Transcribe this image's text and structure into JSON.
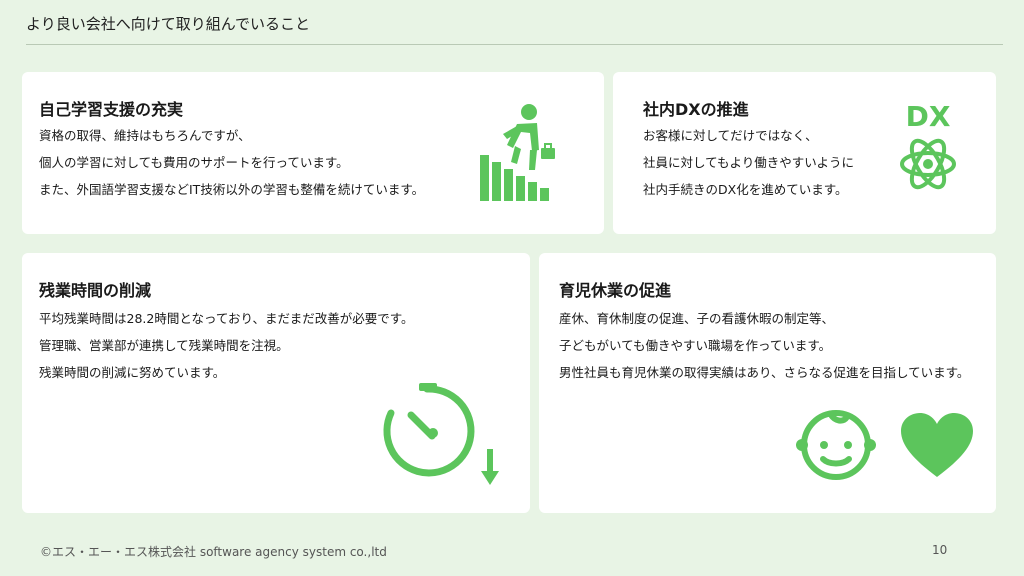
{
  "slide": {
    "title": "より良い会社へ向けて取り組んでいること"
  },
  "cards": [
    {
      "title": "自己学習支援の充実",
      "lines": [
        "資格の取得、維持はもちろんですが、",
        "個人の学習に対しても費用のサポートを行っています。",
        "また、外国語学習支援などIT技術以外の学習も整備を続けています。"
      ],
      "icon": "stair-climber-icon"
    },
    {
      "title": "社内DXの推進",
      "lines": [
        "お客様に対してだけではなく、",
        "社員に対してもより働きやすいように",
        "社内手続きのDX化を進めています。"
      ],
      "icon": "dx-gear-icon",
      "icon_label": "DX"
    },
    {
      "title": "残業時間の削減",
      "lines": [
        "平均残業時間は28.2時間となっており、まだまだ改善が必要です。",
        "管理職、営業部が連携して残業時間を注視。",
        "残業時間の削減に努めています。"
      ],
      "icon": "stopwatch-down-icon"
    },
    {
      "title": "育児休業の促進",
      "lines": [
        "産休、育休制度の促進、子の看護休暇の制定等、",
        "子どもがいても働きやすい職場を作っています。",
        "男性社員も育児休業の取得実績はあり、さらなる促進を目指しています。"
      ],
      "icon": "baby-heart-icon"
    }
  ],
  "footer": {
    "copyright": "©エス・エー・エス株式会社 software agency system co.,ltd",
    "page_number": "10"
  },
  "colors": {
    "background": "#e8f4e5",
    "card": "#ffffff",
    "accent_green": "#5cc55c"
  }
}
